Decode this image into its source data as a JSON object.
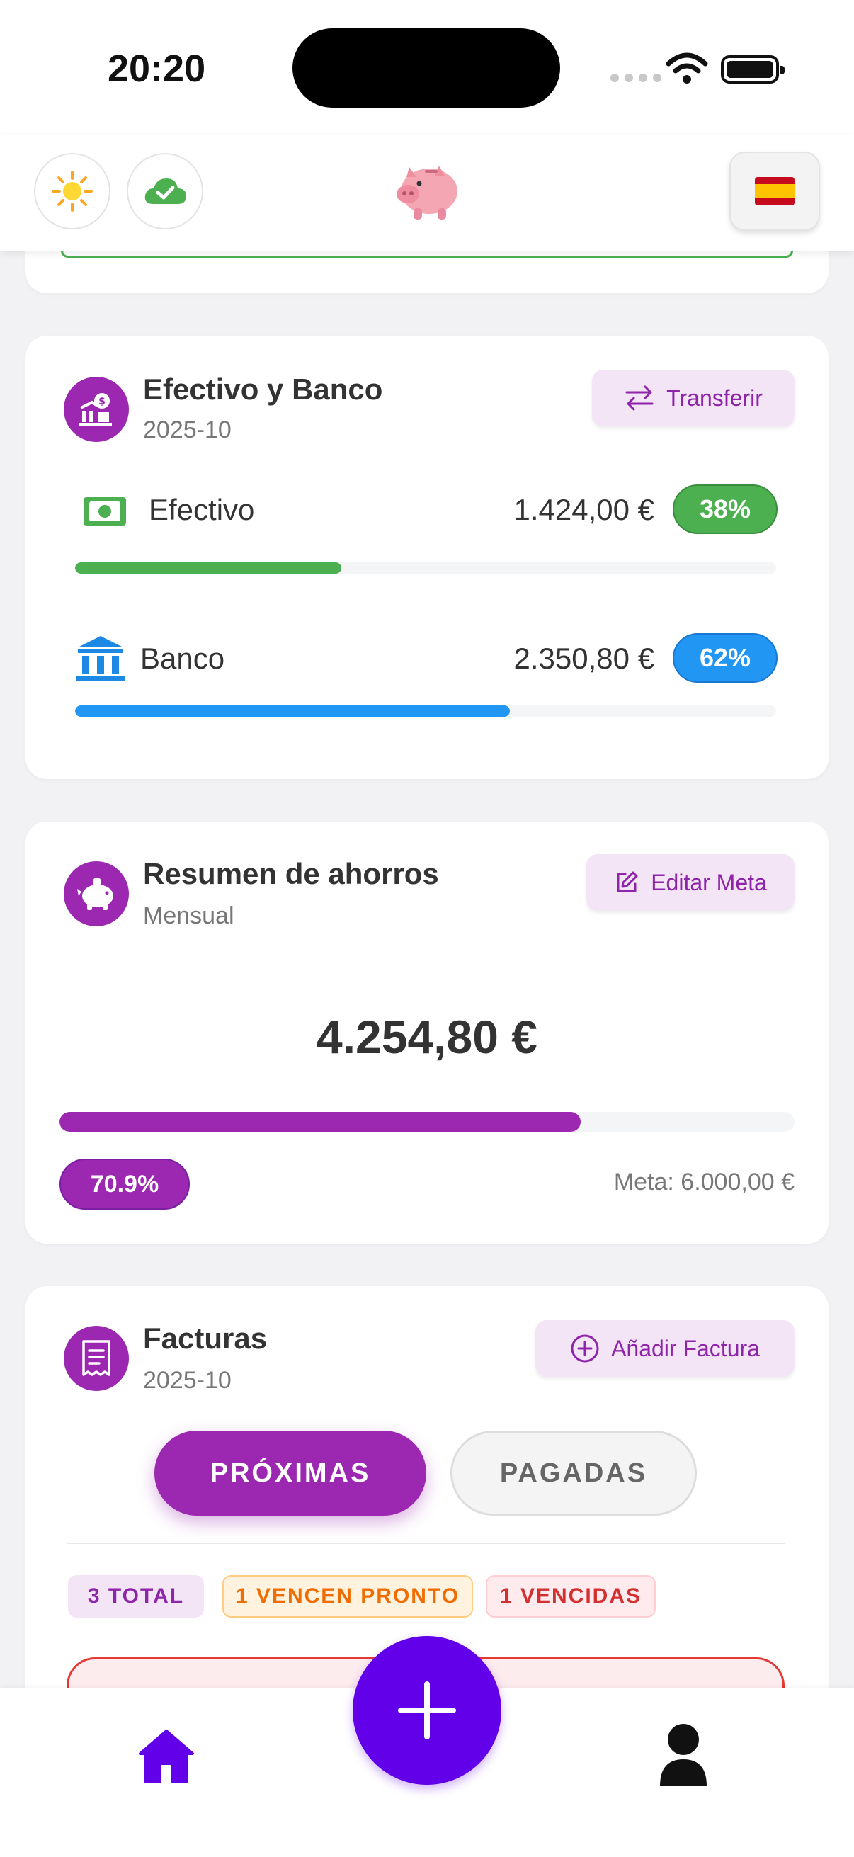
{
  "status_bar": {
    "time": "20:20"
  },
  "top_card": {},
  "cash_bank": {
    "title": "Efectivo y Banco",
    "period": "2025-10",
    "transfer_label": "Transferir",
    "cash": {
      "label": "Efectivo",
      "amount": "1.424,00 €",
      "percent_label": "38%",
      "share": 0.38,
      "color": "#4caf50"
    },
    "bank": {
      "label": "Banco",
      "amount": "2.350,80 €",
      "percent_label": "62%",
      "share": 0.62,
      "color": "#2196f3"
    }
  },
  "savings": {
    "title": "Resumen de ahorros",
    "subtitle": "Mensual",
    "edit_label": "Editar Meta",
    "total": "4.254,80 €",
    "progress_label": "70.9%",
    "progress": 0.709,
    "goal_text": "Meta: 6.000,00 €",
    "color": "#9c27b0"
  },
  "bills": {
    "title": "Facturas",
    "period": "2025-10",
    "add_label": "Añadir Factura",
    "tabs": [
      {
        "label": "PRÓXIMAS",
        "active": true
      },
      {
        "label": "PAGADAS",
        "active": false
      }
    ],
    "badges": {
      "total": "3 TOTAL",
      "due_soon": "1 VENCEN PRONTO",
      "overdue": "1 VENCIDAS"
    }
  },
  "icons": {
    "theme": "sun-icon",
    "sync": "cloud-check-icon",
    "logo": "piggy-bank-icon",
    "language": "spain-flag-icon",
    "home": "home-icon",
    "profile": "person-icon",
    "fab": "plus-icon"
  },
  "colors": {
    "accent": "#9c27b0",
    "fab": "#6200ea",
    "cash": "#4caf50",
    "bank": "#2196f3",
    "overdue": "#e53935"
  }
}
